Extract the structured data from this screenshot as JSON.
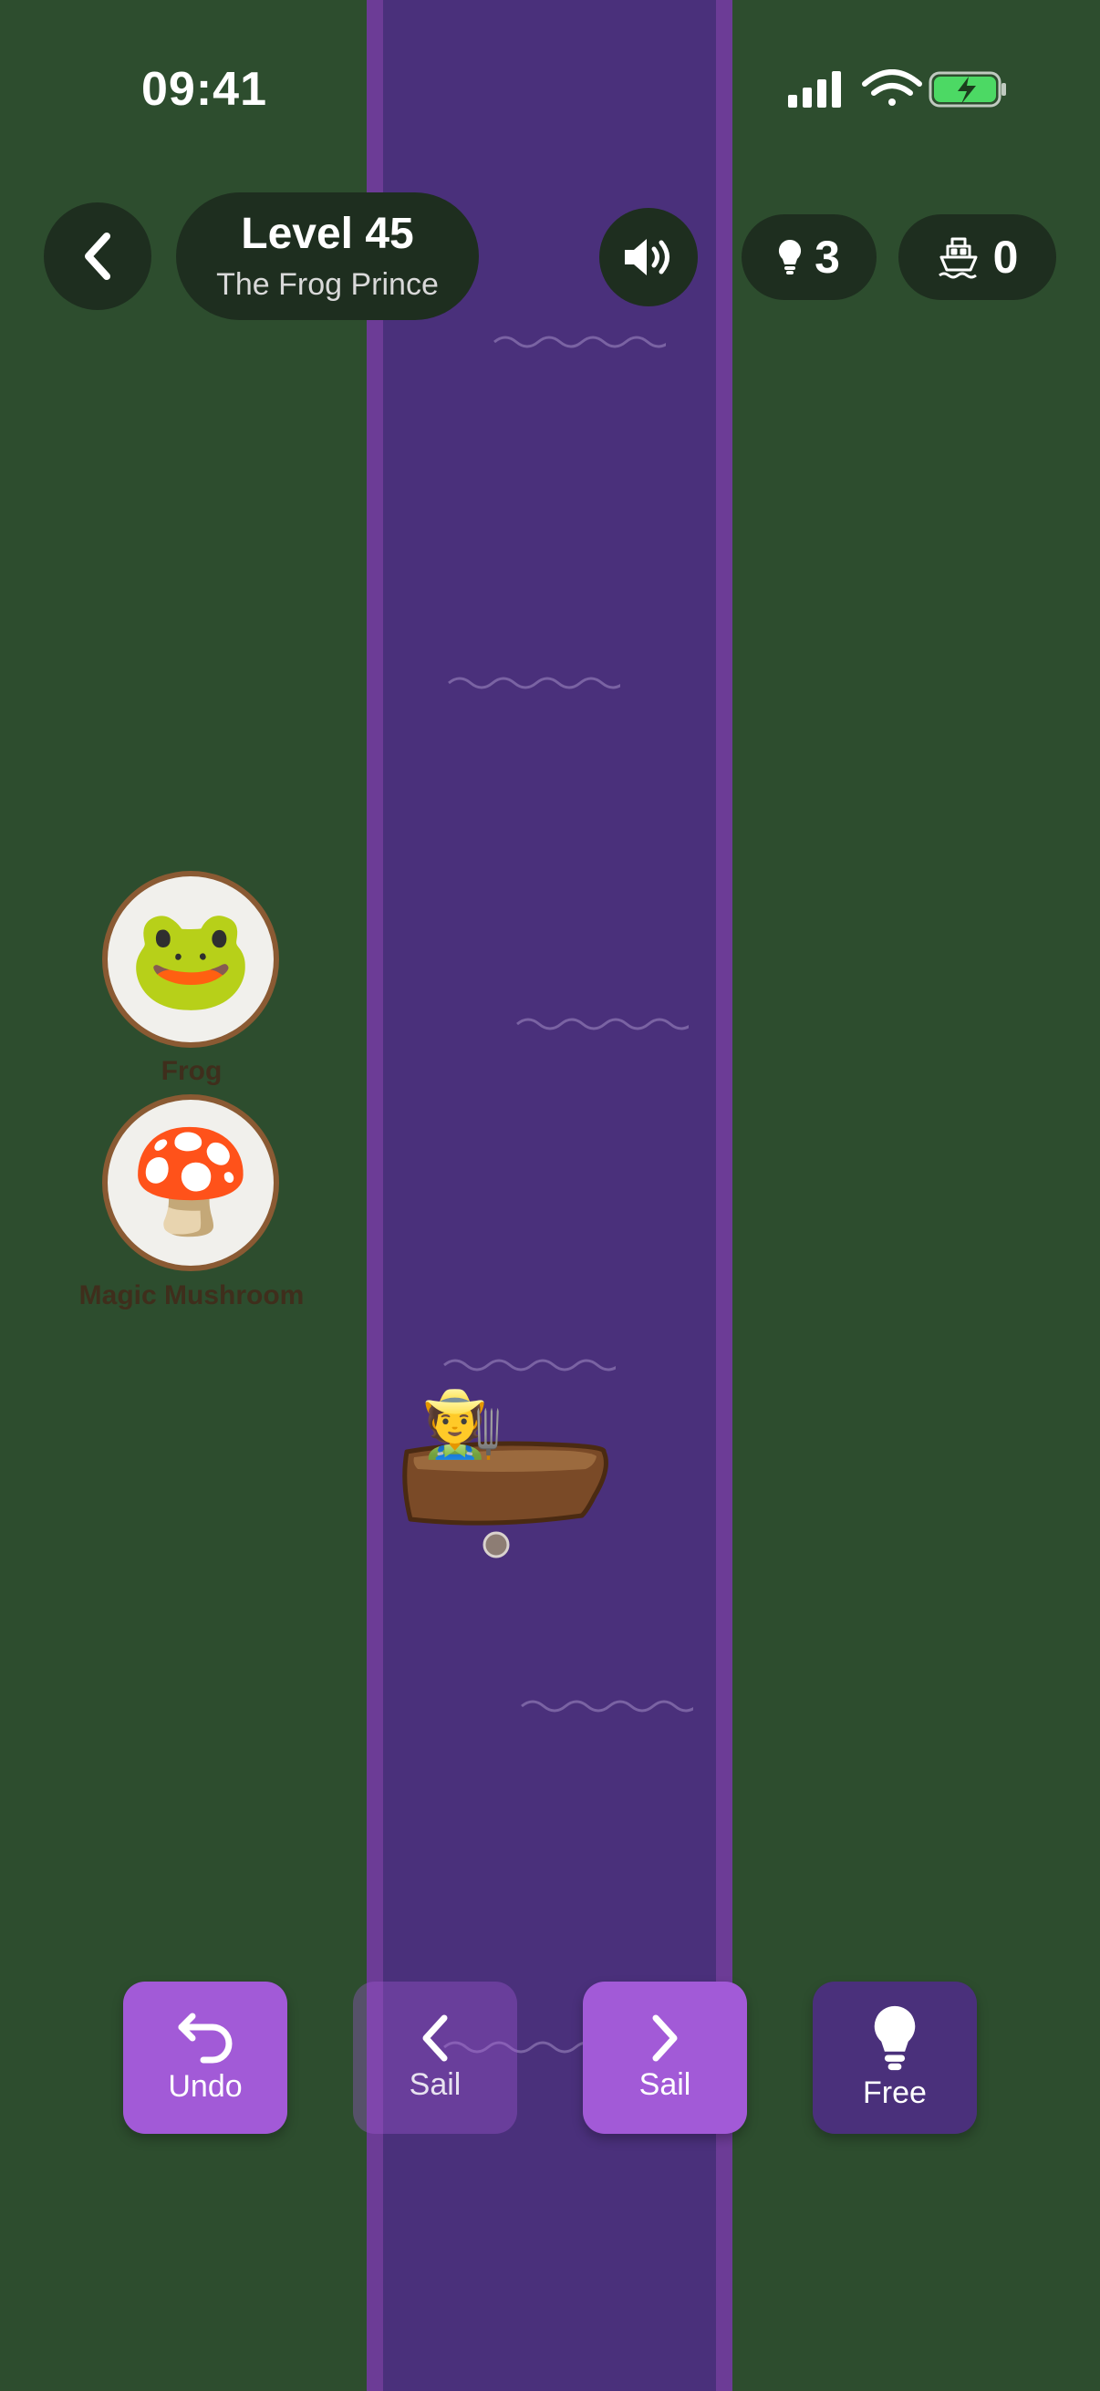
{
  "status_bar": {
    "time": "09:41"
  },
  "header": {
    "level_title": "Level 45",
    "level_subtitle": "The Frog Prince",
    "hints_count": "3",
    "boats_count": "0"
  },
  "bank_left": {
    "items": [
      {
        "emoji": "🐸",
        "label": "Frog"
      },
      {
        "emoji": "🍄",
        "label": "Magic Mushroom"
      }
    ]
  },
  "boat": {
    "passenger_emoji": "🧑‍🌾"
  },
  "controls": {
    "undo_label": "Undo",
    "sail_left_label": "Sail",
    "sail_right_label": "Sail",
    "free_label": "Free"
  },
  "colors": {
    "bank": "#2d4d2e",
    "river": "#4a307b",
    "button_accent": "#a25ad7",
    "pill": "#1e2e1f"
  },
  "icons": {
    "back": "chevron-left-icon",
    "sound": "speaker-icon",
    "hint": "lightbulb-icon",
    "boats": "ferry-icon",
    "undo": "undo-arrow-icon"
  }
}
